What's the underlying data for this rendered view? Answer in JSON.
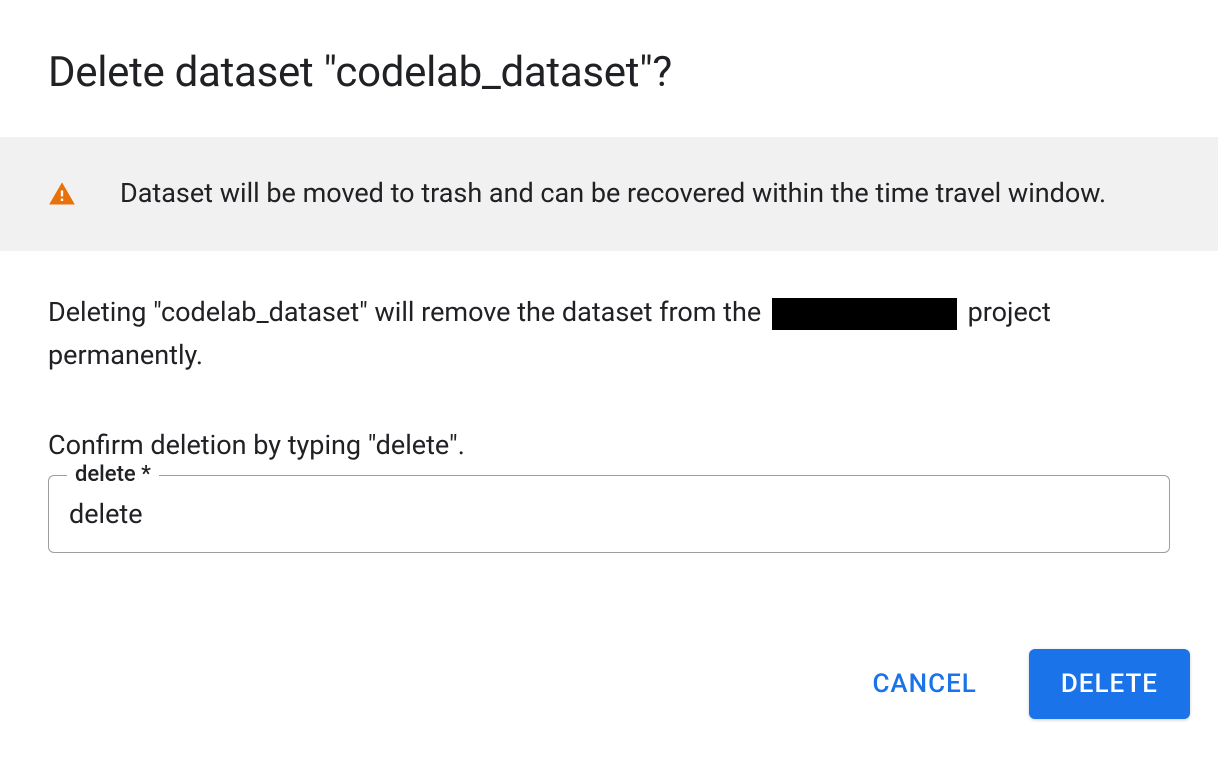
{
  "dialog": {
    "title": "Delete dataset \"codelab_dataset\"?"
  },
  "banner": {
    "message": "Dataset will be moved to trash and can be recovered within the time travel window."
  },
  "body": {
    "text_prefix": "Deleting \"codelab_dataset\" will remove the dataset from the ",
    "text_suffix": " project permanently."
  },
  "confirm": {
    "prompt": "Confirm deletion by typing \"delete\".",
    "field_label": "delete *",
    "input_value": "delete"
  },
  "actions": {
    "cancel_label": "CANCEL",
    "delete_label": "DELETE"
  }
}
